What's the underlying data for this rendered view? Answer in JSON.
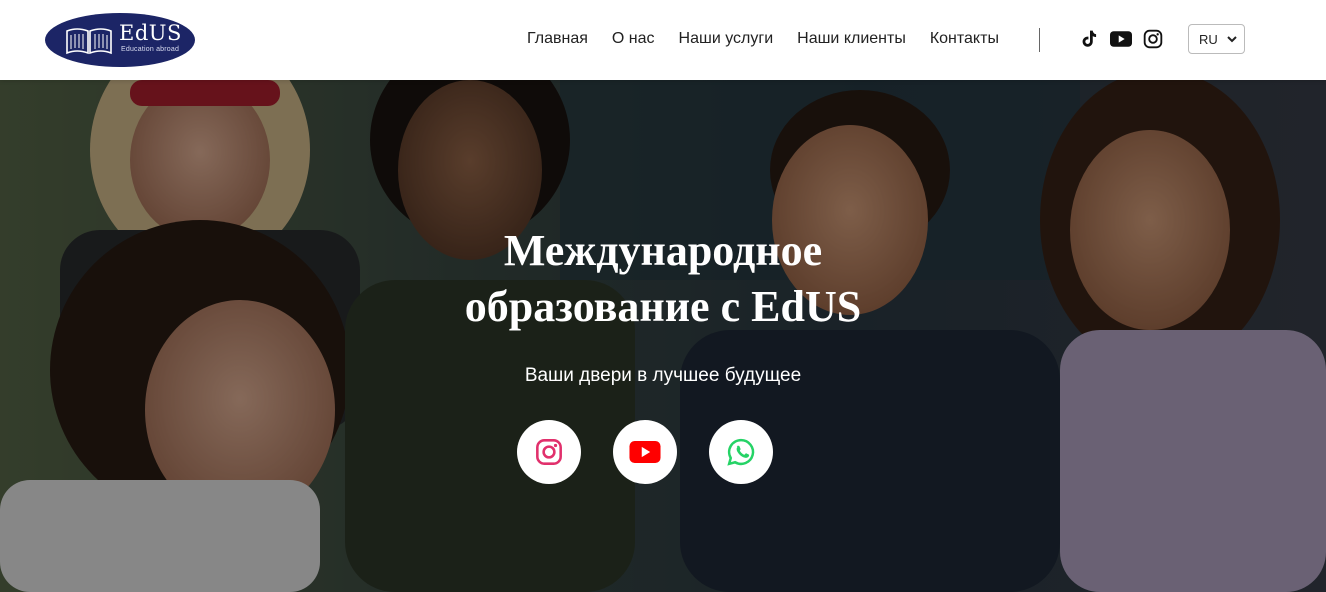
{
  "header": {
    "logo": {
      "name": "EdUS",
      "tagline": "Education abroad"
    },
    "nav": [
      {
        "label": "Главная"
      },
      {
        "label": "О нас"
      },
      {
        "label": "Наши услуги"
      },
      {
        "label": "Наши клиенты"
      },
      {
        "label": "Контакты"
      }
    ],
    "social_icons": [
      "tiktok-icon",
      "youtube-icon",
      "instagram-icon"
    ],
    "language": {
      "selected": "RU"
    }
  },
  "hero": {
    "title_line1": "Международное",
    "title_line2": "образование с EdUS",
    "subtitle": "Ваши двери в лучшее будущее",
    "social_buttons": [
      "instagram-icon",
      "youtube-icon",
      "whatsapp-icon"
    ]
  },
  "colors": {
    "brand_navy": "#1c2566",
    "instagram": "#e1306c",
    "youtube": "#ff0000",
    "whatsapp": "#25d366"
  }
}
